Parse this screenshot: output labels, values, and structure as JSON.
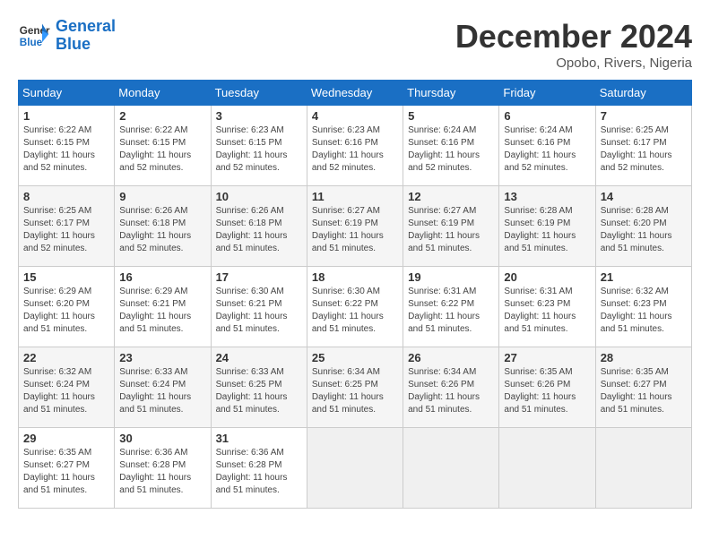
{
  "header": {
    "logo_line1": "General",
    "logo_line2": "Blue",
    "month": "December 2024",
    "location": "Opobo, Rivers, Nigeria"
  },
  "days_of_week": [
    "Sunday",
    "Monday",
    "Tuesday",
    "Wednesday",
    "Thursday",
    "Friday",
    "Saturday"
  ],
  "weeks": [
    [
      {
        "day": "1",
        "info": "Sunrise: 6:22 AM\nSunset: 6:15 PM\nDaylight: 11 hours\nand 52 minutes."
      },
      {
        "day": "2",
        "info": "Sunrise: 6:22 AM\nSunset: 6:15 PM\nDaylight: 11 hours\nand 52 minutes."
      },
      {
        "day": "3",
        "info": "Sunrise: 6:23 AM\nSunset: 6:15 PM\nDaylight: 11 hours\nand 52 minutes."
      },
      {
        "day": "4",
        "info": "Sunrise: 6:23 AM\nSunset: 6:16 PM\nDaylight: 11 hours\nand 52 minutes."
      },
      {
        "day": "5",
        "info": "Sunrise: 6:24 AM\nSunset: 6:16 PM\nDaylight: 11 hours\nand 52 minutes."
      },
      {
        "day": "6",
        "info": "Sunrise: 6:24 AM\nSunset: 6:16 PM\nDaylight: 11 hours\nand 52 minutes."
      },
      {
        "day": "7",
        "info": "Sunrise: 6:25 AM\nSunset: 6:17 PM\nDaylight: 11 hours\nand 52 minutes."
      }
    ],
    [
      {
        "day": "8",
        "info": "Sunrise: 6:25 AM\nSunset: 6:17 PM\nDaylight: 11 hours\nand 52 minutes."
      },
      {
        "day": "9",
        "info": "Sunrise: 6:26 AM\nSunset: 6:18 PM\nDaylight: 11 hours\nand 52 minutes."
      },
      {
        "day": "10",
        "info": "Sunrise: 6:26 AM\nSunset: 6:18 PM\nDaylight: 11 hours\nand 51 minutes."
      },
      {
        "day": "11",
        "info": "Sunrise: 6:27 AM\nSunset: 6:19 PM\nDaylight: 11 hours\nand 51 minutes."
      },
      {
        "day": "12",
        "info": "Sunrise: 6:27 AM\nSunset: 6:19 PM\nDaylight: 11 hours\nand 51 minutes."
      },
      {
        "day": "13",
        "info": "Sunrise: 6:28 AM\nSunset: 6:19 PM\nDaylight: 11 hours\nand 51 minutes."
      },
      {
        "day": "14",
        "info": "Sunrise: 6:28 AM\nSunset: 6:20 PM\nDaylight: 11 hours\nand 51 minutes."
      }
    ],
    [
      {
        "day": "15",
        "info": "Sunrise: 6:29 AM\nSunset: 6:20 PM\nDaylight: 11 hours\nand 51 minutes."
      },
      {
        "day": "16",
        "info": "Sunrise: 6:29 AM\nSunset: 6:21 PM\nDaylight: 11 hours\nand 51 minutes."
      },
      {
        "day": "17",
        "info": "Sunrise: 6:30 AM\nSunset: 6:21 PM\nDaylight: 11 hours\nand 51 minutes."
      },
      {
        "day": "18",
        "info": "Sunrise: 6:30 AM\nSunset: 6:22 PM\nDaylight: 11 hours\nand 51 minutes."
      },
      {
        "day": "19",
        "info": "Sunrise: 6:31 AM\nSunset: 6:22 PM\nDaylight: 11 hours\nand 51 minutes."
      },
      {
        "day": "20",
        "info": "Sunrise: 6:31 AM\nSunset: 6:23 PM\nDaylight: 11 hours\nand 51 minutes."
      },
      {
        "day": "21",
        "info": "Sunrise: 6:32 AM\nSunset: 6:23 PM\nDaylight: 11 hours\nand 51 minutes."
      }
    ],
    [
      {
        "day": "22",
        "info": "Sunrise: 6:32 AM\nSunset: 6:24 PM\nDaylight: 11 hours\nand 51 minutes."
      },
      {
        "day": "23",
        "info": "Sunrise: 6:33 AM\nSunset: 6:24 PM\nDaylight: 11 hours\nand 51 minutes."
      },
      {
        "day": "24",
        "info": "Sunrise: 6:33 AM\nSunset: 6:25 PM\nDaylight: 11 hours\nand 51 minutes."
      },
      {
        "day": "25",
        "info": "Sunrise: 6:34 AM\nSunset: 6:25 PM\nDaylight: 11 hours\nand 51 minutes."
      },
      {
        "day": "26",
        "info": "Sunrise: 6:34 AM\nSunset: 6:26 PM\nDaylight: 11 hours\nand 51 minutes."
      },
      {
        "day": "27",
        "info": "Sunrise: 6:35 AM\nSunset: 6:26 PM\nDaylight: 11 hours\nand 51 minutes."
      },
      {
        "day": "28",
        "info": "Sunrise: 6:35 AM\nSunset: 6:27 PM\nDaylight: 11 hours\nand 51 minutes."
      }
    ],
    [
      {
        "day": "29",
        "info": "Sunrise: 6:35 AM\nSunset: 6:27 PM\nDaylight: 11 hours\nand 51 minutes."
      },
      {
        "day": "30",
        "info": "Sunrise: 6:36 AM\nSunset: 6:28 PM\nDaylight: 11 hours\nand 51 minutes."
      },
      {
        "day": "31",
        "info": "Sunrise: 6:36 AM\nSunset: 6:28 PM\nDaylight: 11 hours\nand 51 minutes."
      },
      null,
      null,
      null,
      null
    ]
  ]
}
